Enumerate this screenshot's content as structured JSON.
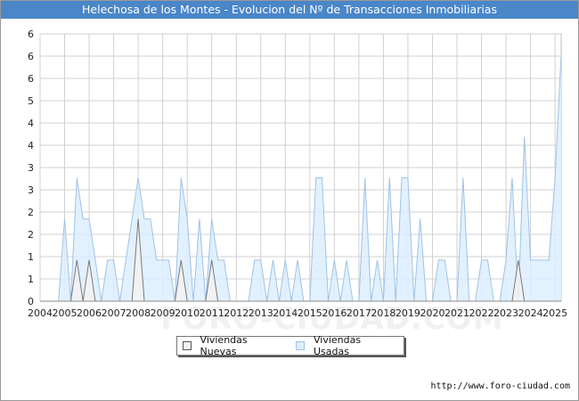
{
  "title": "Helechosa de los Montes - Evolucion del Nº de Transacciones Inmobiliarias",
  "watermark": "FORO-CIUDAD.COM",
  "source": "http://www.foro-ciudad.com",
  "colors": {
    "title_bg": "#4a86c8",
    "nuevas_fill": "#f2f2f2",
    "nuevas_line": "#7a7a7a",
    "usadas_fill": "#ddeeff",
    "usadas_line": "#9fc3e6",
    "grid": "#d0d0d0"
  },
  "chart_data": {
    "type": "area",
    "x_tick_labels": [
      "2004",
      "2005",
      "2006",
      "2007",
      "2008",
      "2009",
      "2010",
      "2011",
      "2012",
      "2013",
      "2014",
      "2015",
      "2016",
      "2017",
      "2018",
      "2019",
      "2020",
      "2021",
      "2022",
      "2023",
      "2024",
      "2025"
    ],
    "y_tick_labels": [
      "0",
      "1",
      "1",
      "2",
      "2",
      "3",
      "3",
      "4",
      "4",
      "5",
      "6",
      "6",
      "6"
    ],
    "ylim": [
      0,
      6.5
    ],
    "xlim": [
      2004,
      2025.25
    ],
    "grid": true,
    "legend_position": "bottom-center",
    "series": [
      {
        "name": "Viviendas Nuevas",
        "points": [
          [
            2004,
            0
          ],
          [
            2004.75,
            0
          ],
          [
            2005,
            0
          ],
          [
            2005.25,
            0
          ],
          [
            2005.5,
            1
          ],
          [
            2005.75,
            0
          ],
          [
            2006,
            1
          ],
          [
            2006.25,
            0
          ],
          [
            2006.5,
            0
          ],
          [
            2006.75,
            0
          ],
          [
            2007,
            0
          ],
          [
            2007.25,
            0
          ],
          [
            2007.5,
            0
          ],
          [
            2007.75,
            0
          ],
          [
            2008,
            2
          ],
          [
            2008.25,
            0
          ],
          [
            2008.5,
            0
          ],
          [
            2008.75,
            0
          ],
          [
            2009,
            0
          ],
          [
            2009.25,
            0
          ],
          [
            2009.5,
            0
          ],
          [
            2009.75,
            1
          ],
          [
            2010,
            0
          ],
          [
            2010.25,
            0
          ],
          [
            2010.5,
            0
          ],
          [
            2010.75,
            0
          ],
          [
            2011,
            1
          ],
          [
            2011.25,
            0
          ],
          [
            2023.25,
            0
          ],
          [
            2023.5,
            1
          ],
          [
            2023.75,
            0
          ],
          [
            2025.25,
            0
          ]
        ]
      },
      {
        "name": "Viviendas Usadas",
        "points": [
          [
            2004,
            0
          ],
          [
            2004.75,
            0
          ],
          [
            2005,
            2
          ],
          [
            2005.25,
            0
          ],
          [
            2005.5,
            3
          ],
          [
            2005.75,
            2
          ],
          [
            2006,
            2
          ],
          [
            2006.25,
            1
          ],
          [
            2006.5,
            0
          ],
          [
            2006.75,
            1
          ],
          [
            2007,
            1
          ],
          [
            2007.25,
            0
          ],
          [
            2007.5,
            1
          ],
          [
            2007.75,
            2
          ],
          [
            2008,
            3
          ],
          [
            2008.25,
            2
          ],
          [
            2008.5,
            2
          ],
          [
            2008.75,
            1
          ],
          [
            2009,
            1
          ],
          [
            2009.25,
            1
          ],
          [
            2009.5,
            0
          ],
          [
            2009.75,
            3
          ],
          [
            2010,
            2
          ],
          [
            2010.25,
            0
          ],
          [
            2010.5,
            2
          ],
          [
            2010.75,
            0
          ],
          [
            2011,
            2
          ],
          [
            2011.25,
            1
          ],
          [
            2011.5,
            1
          ],
          [
            2011.75,
            0
          ],
          [
            2012,
            0
          ],
          [
            2012.25,
            0
          ],
          [
            2012.5,
            0
          ],
          [
            2012.75,
            1
          ],
          [
            2013,
            1
          ],
          [
            2013.25,
            0
          ],
          [
            2013.5,
            1
          ],
          [
            2013.75,
            0
          ],
          [
            2014,
            1
          ],
          [
            2014.25,
            0
          ],
          [
            2014.5,
            1
          ],
          [
            2014.75,
            0
          ],
          [
            2015,
            0
          ],
          [
            2015.25,
            3
          ],
          [
            2015.5,
            3
          ],
          [
            2015.75,
            0
          ],
          [
            2016,
            1
          ],
          [
            2016.25,
            0
          ],
          [
            2016.5,
            1
          ],
          [
            2016.75,
            0
          ],
          [
            2017,
            0
          ],
          [
            2017.25,
            3
          ],
          [
            2017.5,
            0
          ],
          [
            2017.75,
            1
          ],
          [
            2018,
            0
          ],
          [
            2018.25,
            3
          ],
          [
            2018.5,
            0
          ],
          [
            2018.75,
            3
          ],
          [
            2019,
            3
          ],
          [
            2019.25,
            0
          ],
          [
            2019.5,
            2
          ],
          [
            2019.75,
            0
          ],
          [
            2020,
            0
          ],
          [
            2020.25,
            1
          ],
          [
            2020.5,
            1
          ],
          [
            2020.75,
            0
          ],
          [
            2021,
            0
          ],
          [
            2021.25,
            3
          ],
          [
            2021.5,
            0
          ],
          [
            2021.75,
            0
          ],
          [
            2022,
            1
          ],
          [
            2022.25,
            1
          ],
          [
            2022.5,
            0
          ],
          [
            2022.75,
            0
          ],
          [
            2023,
            1
          ],
          [
            2023.25,
            3
          ],
          [
            2023.5,
            0
          ],
          [
            2023.75,
            4
          ],
          [
            2024,
            1
          ],
          [
            2024.25,
            1
          ],
          [
            2024.5,
            1
          ],
          [
            2024.75,
            1
          ],
          [
            2025,
            3
          ],
          [
            2025.25,
            6
          ]
        ]
      }
    ],
    "legend": [
      "Viviendas Nuevas",
      "Viviendas Usadas"
    ]
  }
}
